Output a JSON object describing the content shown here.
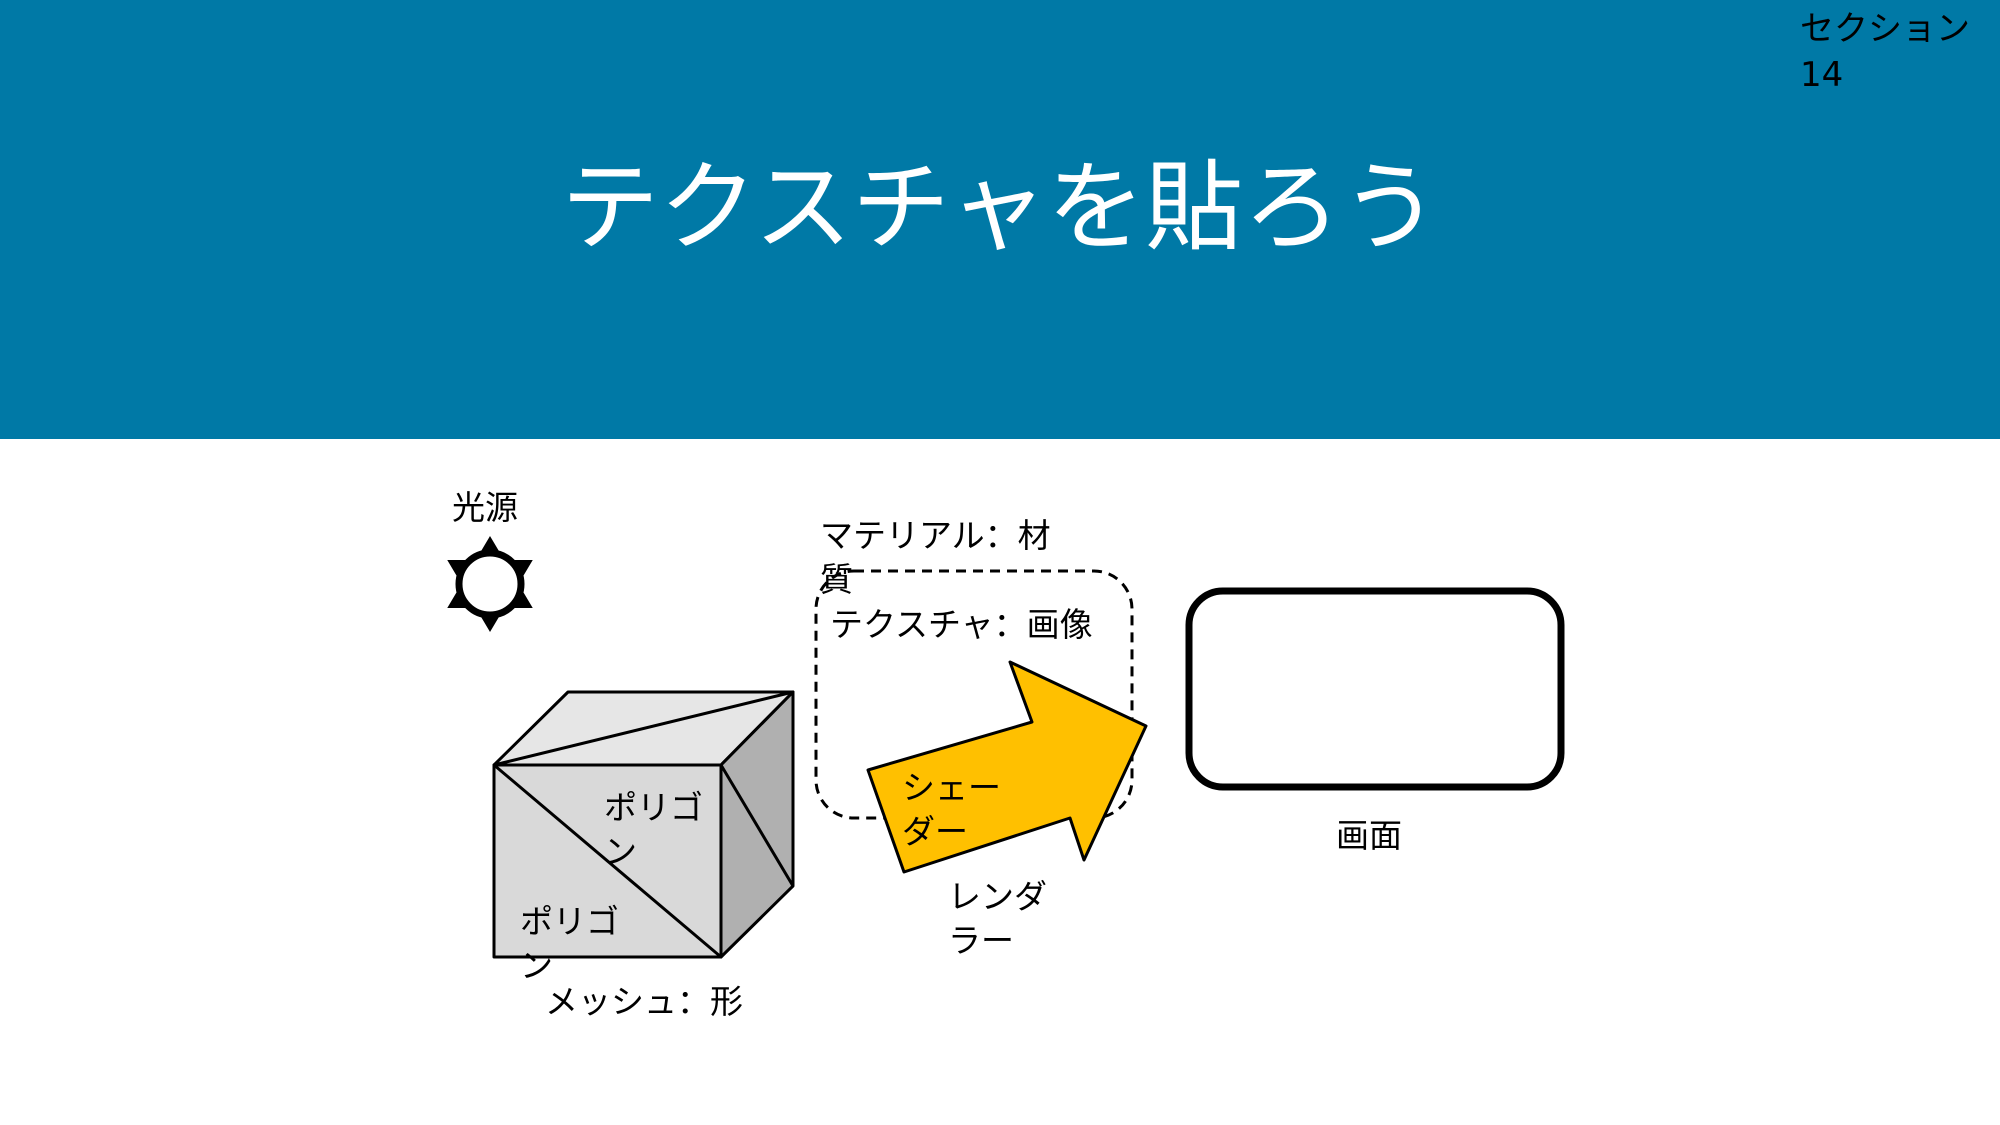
{
  "header": {
    "section": "セクション\n14",
    "title": "テクスチャを貼ろう"
  },
  "diagram": {
    "light_source": "光源",
    "material": "マテリアル：材\n質",
    "texture": "テクスチャ：画像",
    "polygon_top": "ポリゴ\nン",
    "polygon_bottom": "ポリゴ\nン",
    "mesh": "メッシュ：形",
    "shader": "シェー\nダー",
    "renderer": "レンダ\nラー",
    "screen": "画面"
  },
  "colors": {
    "header_bg": "#0079a6",
    "title_text": "#ffffff",
    "arrow_fill": "#ffc000",
    "cube_front": "#d9d9d9",
    "cube_top": "#e6e6e6",
    "cube_side": "#b0b0b0"
  }
}
